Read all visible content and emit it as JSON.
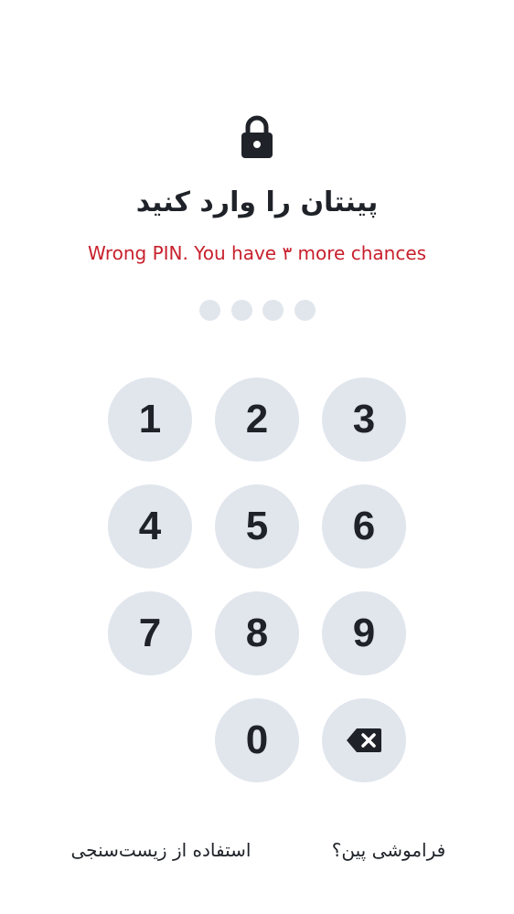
{
  "header": {
    "lock_icon": "lock-icon",
    "title": "پینتان را وارد کنید",
    "error": "Wrong PIN. You have ۳ more chances"
  },
  "pin": {
    "length": 4,
    "entered": 0
  },
  "keypad": {
    "keys": [
      "1",
      "2",
      "3",
      "4",
      "5",
      "6",
      "7",
      "8",
      "9",
      "0"
    ],
    "backspace_icon": "backspace-icon"
  },
  "footer": {
    "biometric_label": "استفاده از زیست‌سنجی",
    "forgot_label": "فراموشی پین؟"
  },
  "colors": {
    "background": "#ffffff",
    "text": "#1f2329",
    "error": "#c8202d",
    "key_fill": "#e1e6ed"
  }
}
